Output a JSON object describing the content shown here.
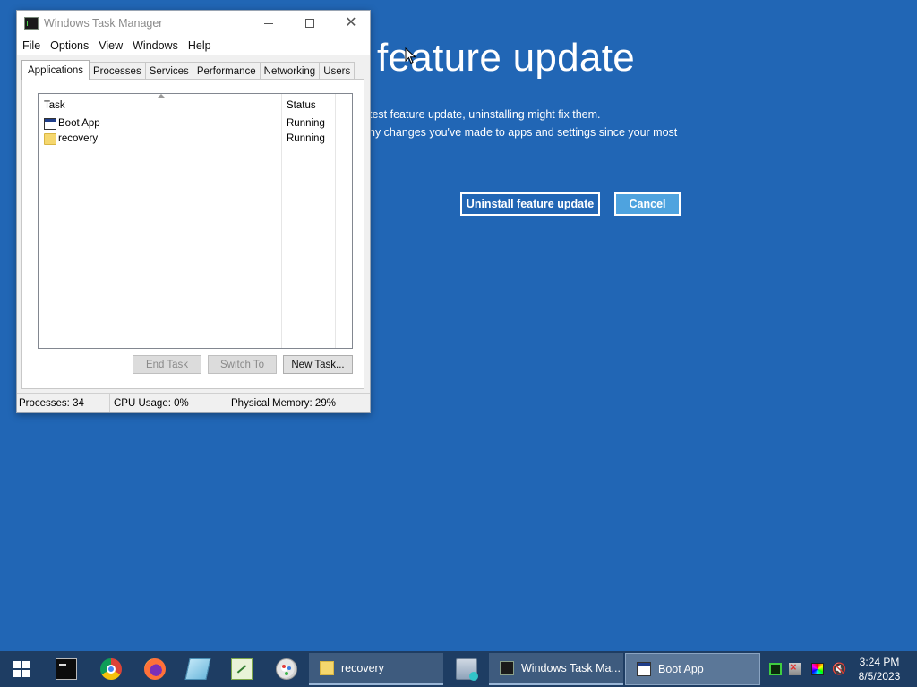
{
  "background": {
    "title": "feature update",
    "line1": "test feature update, uninstalling might fix them.",
    "line2": "ny changes you've made to apps and settings since your most",
    "uninstall_button": "Uninstall feature update",
    "cancel_button": "Cancel"
  },
  "task_manager": {
    "title": "Windows Task Manager",
    "menu": [
      "File",
      "Options",
      "View",
      "Windows",
      "Help"
    ],
    "tabs": [
      "Applications",
      "Processes",
      "Services",
      "Performance",
      "Networking",
      "Users"
    ],
    "active_tab": "Applications",
    "columns": {
      "task": "Task",
      "status": "Status"
    },
    "rows": [
      {
        "name": "Boot App",
        "status": "Running",
        "icon": "window-icon"
      },
      {
        "name": "recovery",
        "status": "Running",
        "icon": "folder-icon"
      }
    ],
    "buttons": {
      "end_task": "End Task",
      "switch_to": "Switch To",
      "new_task": "New Task..."
    },
    "status": {
      "processes": "Processes: 34",
      "cpu": "CPU Usage: 0%",
      "memory": "Physical Memory: 29%"
    }
  },
  "taskbar": {
    "pinned": [
      "command-prompt-icon",
      "chrome-icon",
      "firefox-icon",
      "notes-icon",
      "editor-icon",
      "paint-icon",
      "network-drive-icon"
    ],
    "windows": [
      "recovery",
      "Windows Task Ma...",
      "Boot App"
    ],
    "clock": {
      "time": "3:24 PM",
      "date": "8/5/2023"
    }
  },
  "colors": {
    "desktop": "#2166b5",
    "taskbar": "#1e3d63",
    "cancel": "#4ea3df"
  }
}
